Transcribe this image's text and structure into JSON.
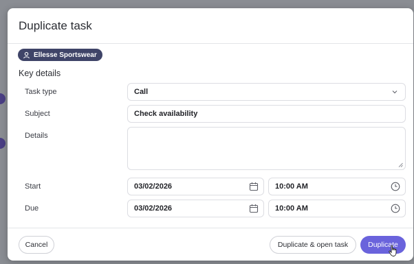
{
  "modal": {
    "title": "Duplicate task",
    "account_badge": "Ellesse Sportswear",
    "section_title": "Key details"
  },
  "form": {
    "task_type": {
      "label": "Task type",
      "value": "Call"
    },
    "subject": {
      "label": "Subject",
      "value": "Check availability"
    },
    "details": {
      "label": "Details",
      "value": ""
    },
    "start": {
      "label": "Start",
      "date": "03/02/2026",
      "time": "10:00 AM"
    },
    "due": {
      "label": "Due",
      "date": "03/02/2026",
      "time": "10:00 AM"
    }
  },
  "footer": {
    "cancel": "Cancel",
    "duplicate_open": "Duplicate & open task",
    "duplicate": "Duplicate"
  },
  "colors": {
    "primary": "#6a63dc",
    "badge": "#3f4468",
    "backdrop": "#8a8d93"
  },
  "icons": [
    "user-icon",
    "chevron-down-icon",
    "calendar-icon",
    "clock-icon",
    "resize-handle-icon",
    "hand-cursor-icon"
  ]
}
